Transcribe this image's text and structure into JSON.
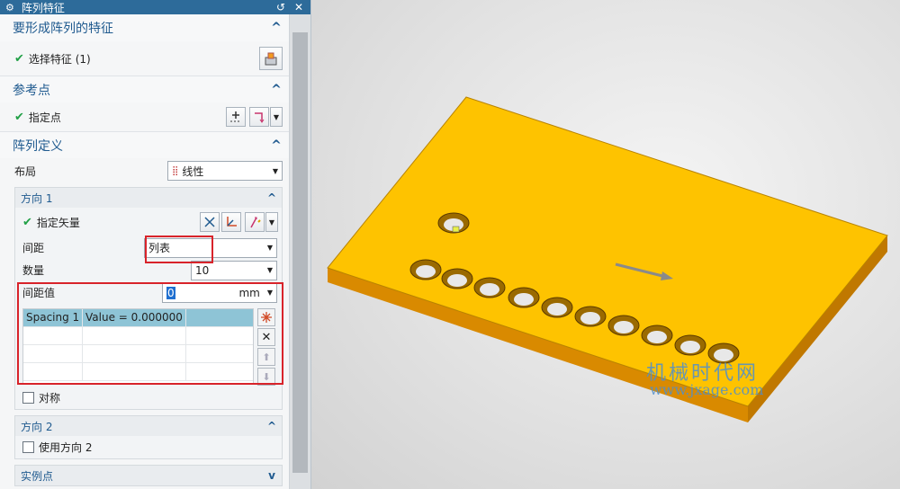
{
  "dialog": {
    "title": "阵列特征",
    "reset_icon": "↺",
    "close_icon": "✕"
  },
  "features_section": {
    "title": "要形成阵列的特征",
    "select_label": "选择特征 (1)"
  },
  "reference_section": {
    "title": "参考点",
    "specify_point_label": "指定点"
  },
  "pattern_section": {
    "title": "阵列定义",
    "layout_label": "布局",
    "layout_value": "线性"
  },
  "direction1": {
    "title": "方向 1",
    "vector_label": "指定矢量",
    "spacing_label": "间距",
    "spacing_value": "列表",
    "count_label": "数量",
    "count_value": "10",
    "spacing_value_label": "间距值",
    "spacing_input": "0",
    "spacing_unit": "mm",
    "list": {
      "rows": [
        {
          "name": "Spacing 1",
          "value": "Value = 0.000000"
        },
        {
          "name": "",
          "value": ""
        },
        {
          "name": "",
          "value": ""
        },
        {
          "name": "",
          "value": ""
        }
      ]
    },
    "symmetric_label": "对称"
  },
  "direction2": {
    "title": "方向 2",
    "use_direction_label": "使用方向 2"
  },
  "instance_section": {
    "title": "实例点"
  },
  "watermark": {
    "line1": "机械时代网",
    "line2": "www.jxage.com"
  },
  "colors": {
    "plate_top": "#fec300",
    "plate_side": "#d98a00",
    "accent": "#1f5a8f",
    "highlight_red": "#d8232a"
  }
}
